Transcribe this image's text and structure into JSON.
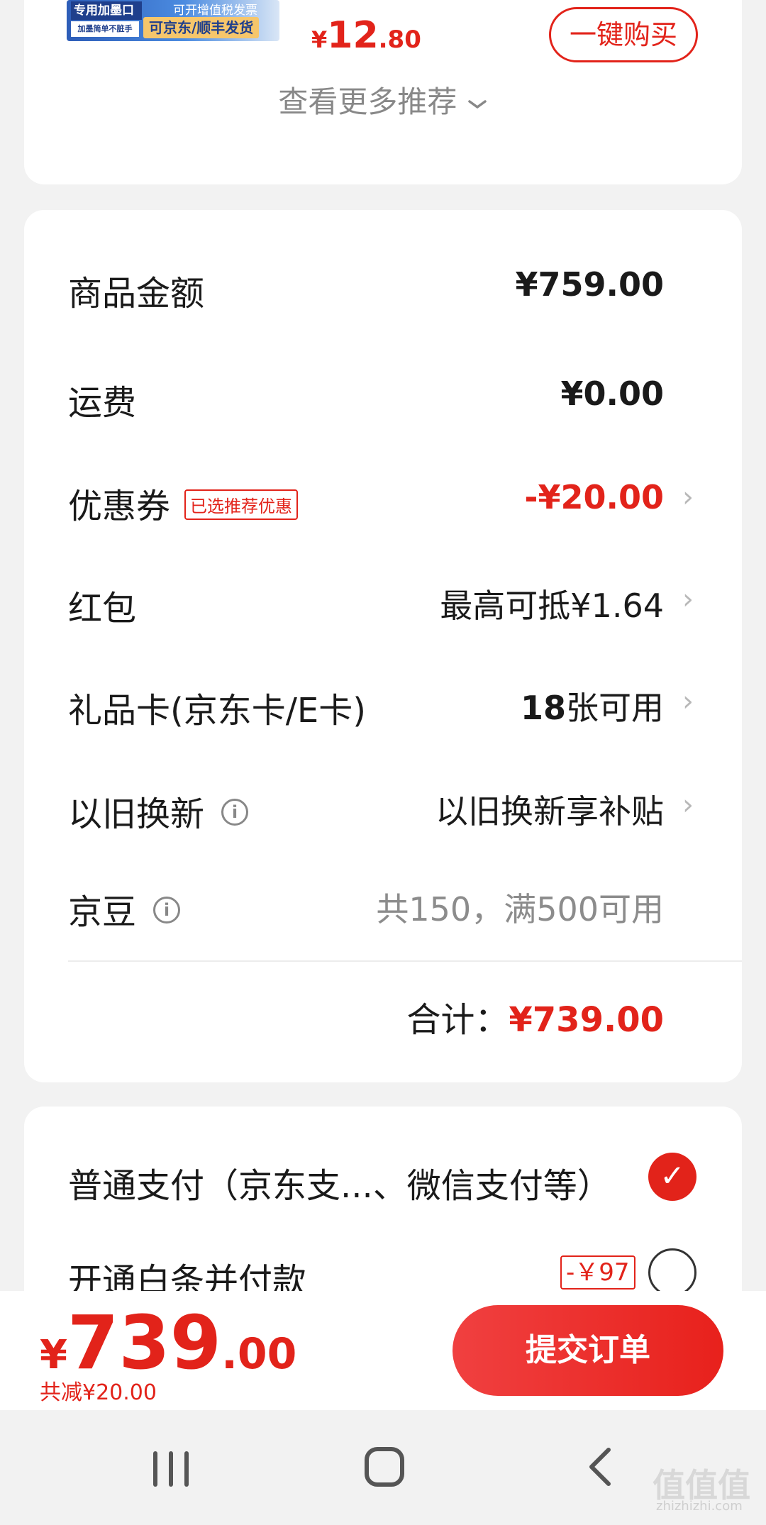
{
  "recommend": {
    "thumb_line1": "专用加墨口",
    "thumb_line2": "加墨简单不脏手",
    "thumb_line3": "可开增值税发票",
    "thumb_line4": "可京东/顺丰发货",
    "price_currency": "¥",
    "price_int": "12",
    "price_dec": ".80",
    "buy_button": "一键购买",
    "more_label": "查看更多推荐",
    "more_icon": "chevron-down-icon"
  },
  "price_detail": {
    "items": [
      {
        "label": "商品金额",
        "value": "¥759.00"
      },
      {
        "label": "运费",
        "value": "¥0.00"
      },
      {
        "label": "优惠券",
        "tag": "已选推荐优惠",
        "value": "-¥20.00"
      },
      {
        "label": "红包",
        "value": "最高可抵¥1.64"
      },
      {
        "label": "礼品卡(京东卡/E卡)",
        "value_num": "18",
        "value_text": "张可用"
      },
      {
        "label": "以旧换新",
        "value": "以旧换新享补贴",
        "icon": "info-icon"
      },
      {
        "label": "京豆",
        "value": "共150，满500可用",
        "icon": "info-icon"
      }
    ],
    "total_label": "合计：",
    "total_value": "¥739.00",
    "chevron": "›",
    "info_glyph": "i"
  },
  "payment": {
    "option1": "普通支付（京东支...、微信支付等）",
    "option2": "开通白条并付款",
    "option2_tag": "-￥97",
    "check_glyph": "✓"
  },
  "bottom_bar": {
    "currency": "¥",
    "price_int": "739",
    "price_dec": ".00",
    "saved": "共减¥20.00",
    "submit": "提交订单"
  },
  "watermark": {
    "main": "值值值",
    "sub": "zhizhizhi.com"
  },
  "colors": {
    "accent": "#e2231a",
    "background": "#f2f2f2",
    "card": "#ffffff"
  }
}
